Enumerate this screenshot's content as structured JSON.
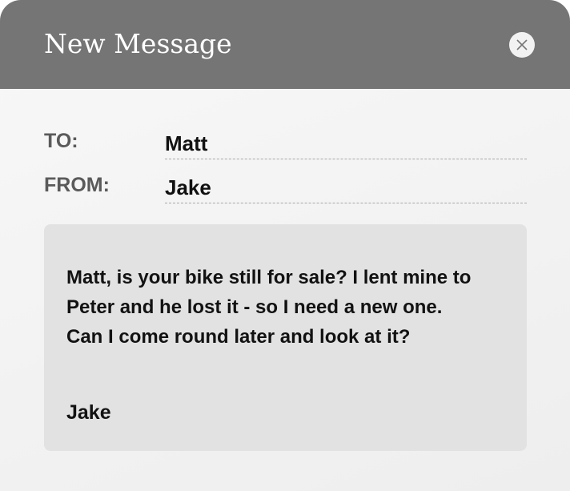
{
  "window": {
    "title": "New Message",
    "close_icon": "close-icon"
  },
  "fields": {
    "to_label": "TO:",
    "to_value": "Matt",
    "from_label": "FROM:",
    "from_value": "Jake"
  },
  "message": {
    "body": "Matt, is your bike still for sale? I lent mine to Peter and he lost it - so I need a new one. Can I come round later and look at it?",
    "signature": "Jake"
  },
  "colors": {
    "titlebar": "#757575",
    "message_box": "#e2e2e2"
  }
}
